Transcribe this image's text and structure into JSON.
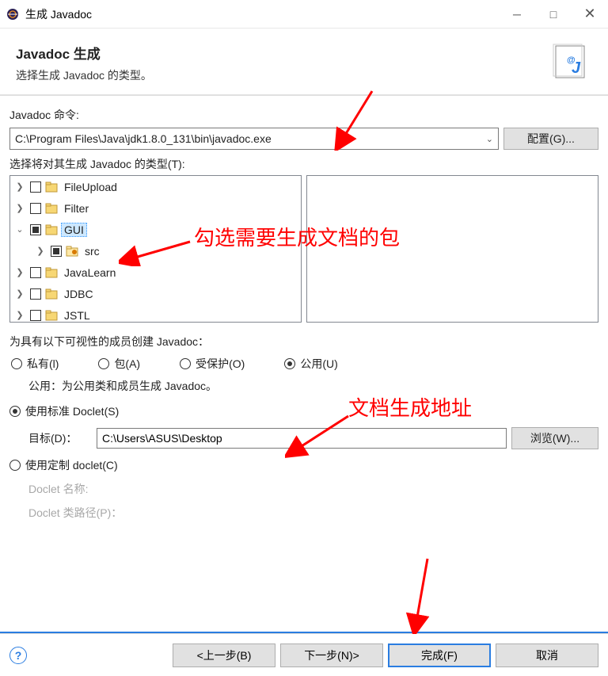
{
  "titlebar": {
    "title": "生成 Javadoc"
  },
  "header": {
    "title": "Javadoc 生成",
    "subtitle": "选择生成 Javadoc 的类型。"
  },
  "command": {
    "label": "Javadoc 命令:",
    "value": "C:\\Program Files\\Java\\jdk1.8.0_131\\bin\\javadoc.exe",
    "config_btn": "配置(G)..."
  },
  "types_label": "选择将对其生成 Javadoc 的类型(T):",
  "tree": [
    {
      "name": "FileUpload",
      "exp": "❯",
      "check": "empty",
      "sel": false
    },
    {
      "name": "Filter",
      "exp": "❯",
      "check": "empty",
      "sel": false
    },
    {
      "name": "GUI",
      "exp": "⌄",
      "check": "partial",
      "sel": true
    },
    {
      "name": "src",
      "exp": "❯",
      "check": "partial",
      "sel": false,
      "child": true,
      "icon": "src"
    },
    {
      "name": "JavaLearn",
      "exp": "❯",
      "check": "empty",
      "sel": false
    },
    {
      "name": "JDBC",
      "exp": "❯",
      "check": "empty",
      "sel": false
    },
    {
      "name": "JSTL",
      "exp": "❯",
      "check": "empty",
      "sel": false
    }
  ],
  "visibility": {
    "label": "为具有以下可视性的成员创建 Javadoc：",
    "opts": {
      "private": "私有(l)",
      "package": "包(A)",
      "protected": "受保护(O)",
      "public": "公用(U)"
    },
    "desc": "公用：为公用类和成员生成 Javadoc。"
  },
  "doclet": {
    "standard": "使用标准 Doclet(S)",
    "target_lbl": "目标(D)：",
    "target_val": "C:\\Users\\ASUS\\Desktop",
    "browse": "浏览(W)...",
    "custom": "使用定制 doclet(C)",
    "name_lbl": "Doclet 名称:",
    "path_lbl": "Doclet 类路径(P)："
  },
  "footer": {
    "back": "<上一步(B)",
    "next": "下一步(N)>",
    "finish": "完成(F)",
    "cancel": "取消"
  },
  "annotations": {
    "a1": "勾选需要生成文档的包",
    "a2": "文档生成地址"
  }
}
